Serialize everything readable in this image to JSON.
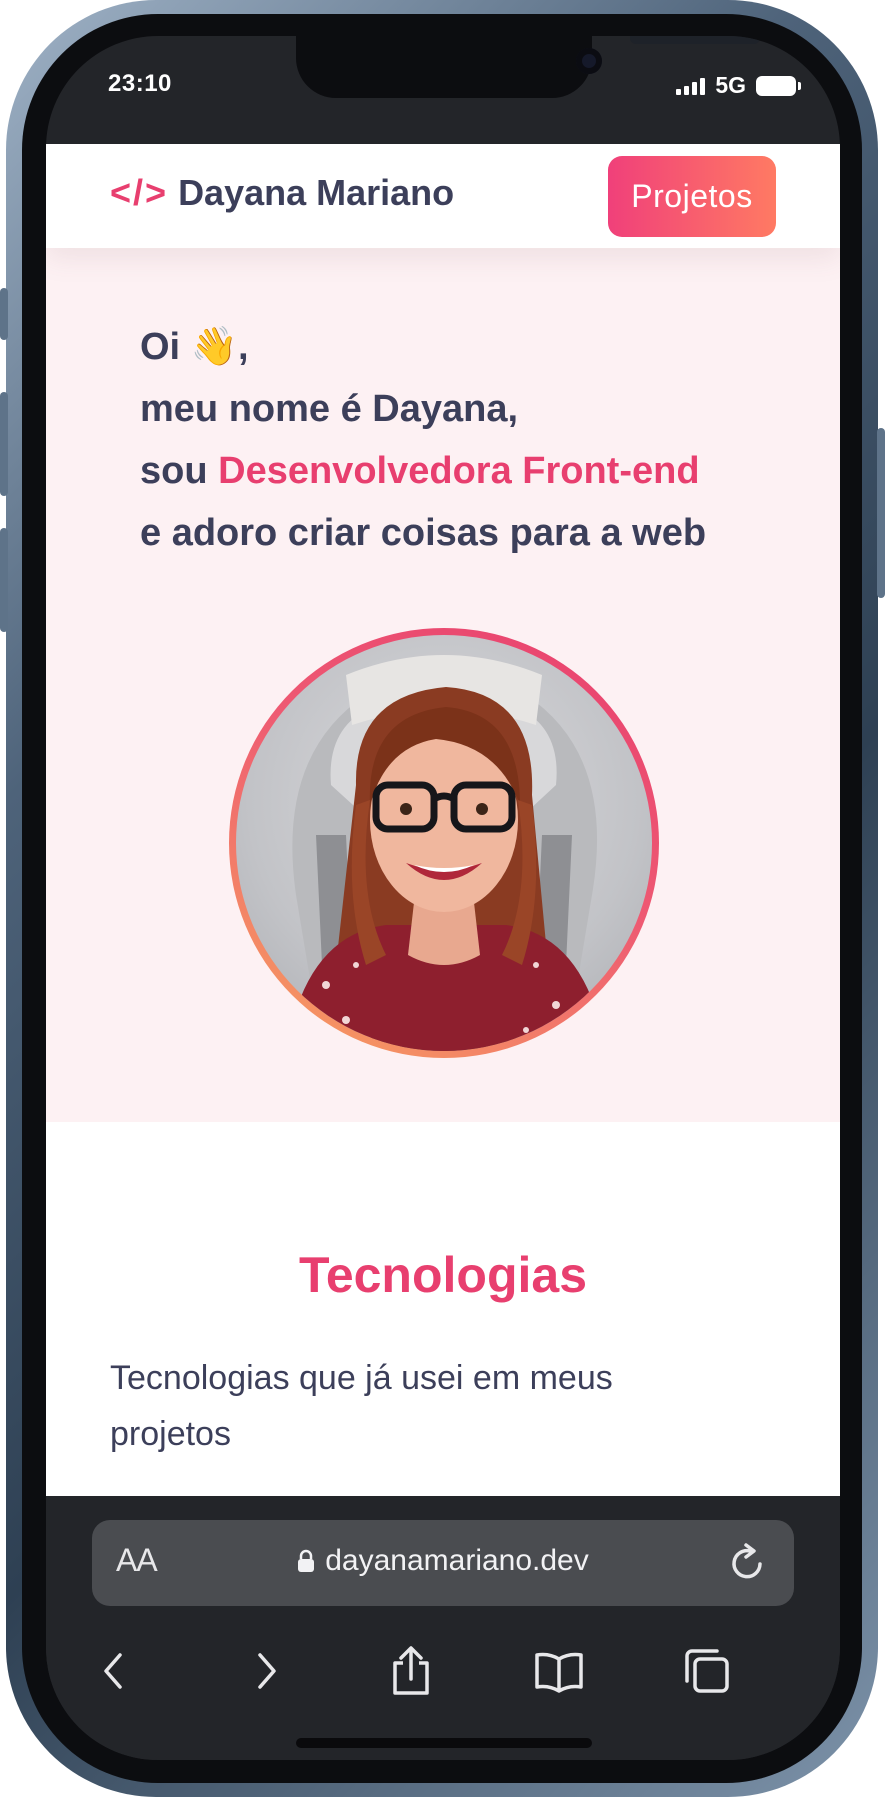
{
  "status_bar": {
    "time": "23:10",
    "network": "5G"
  },
  "header": {
    "logo_code": "</>",
    "logo_name": "Dayana Mariano",
    "projects_button": "Projetos"
  },
  "hero": {
    "greeting": "Oi 👋,",
    "line2": "meu nome é Dayana,",
    "line3_prefix": "sou ",
    "line3_accent": "Desenvolvedora Front-end",
    "line4": "e adoro criar coisas para a web"
  },
  "technologies": {
    "title": "Tecnologias",
    "subtitle": "Tecnologias que já usei em meus projetos"
  },
  "browser": {
    "text_size_label": "AA",
    "url": "dayanamariano.dev"
  },
  "colors": {
    "accent": "#e83f6f",
    "text_dark": "#3c3f5a",
    "hero_bg": "#fdf1f3",
    "button_gradient_start": "#f0407a",
    "button_gradient_end": "#ff7a63"
  }
}
